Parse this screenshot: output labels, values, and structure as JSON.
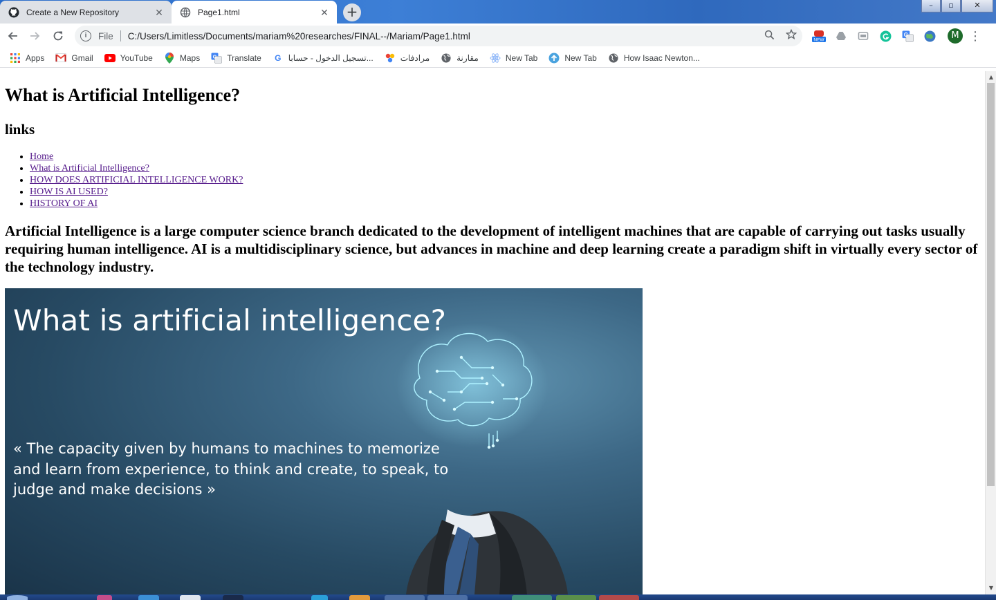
{
  "browser": {
    "tabs": [
      {
        "title": "Create a New Repository",
        "icon": "github-icon",
        "active": false
      },
      {
        "title": "Page1.html",
        "icon": "globe-icon",
        "active": true
      }
    ],
    "window_controls": {
      "minimize": "–",
      "maximize": "▫",
      "close": "✕"
    },
    "address": {
      "scheme": "File",
      "url": "C:/Users/Limitless/Documents/mariam%20researches/FINAL--/Mariam/Page1.html"
    },
    "profile_initial": "M",
    "extensions": [
      {
        "name": "new-badge-extension",
        "color": "#d93025",
        "badge": "NEW"
      },
      {
        "name": "drive-extension",
        "color": "#9aa0a6"
      },
      {
        "name": "cast-extension",
        "color": "#9aa0a6"
      },
      {
        "name": "grammarly-extension",
        "color": "#15c39a"
      },
      {
        "name": "translate-extension",
        "color": "#4285f4"
      },
      {
        "name": "globe-extension",
        "color": "#34a853"
      }
    ],
    "bookmarks": [
      {
        "label": "Apps",
        "icon": "apps-grid-icon"
      },
      {
        "label": "Gmail",
        "icon": "gmail-icon"
      },
      {
        "label": "YouTube",
        "icon": "youtube-icon"
      },
      {
        "label": "Maps",
        "icon": "maps-pin-icon"
      },
      {
        "label": "Translate",
        "icon": "translate-icon"
      },
      {
        "label": "تسجيل الدخول - حسابا...",
        "icon": "google-icon"
      },
      {
        "label": "مرادفات",
        "icon": "people-icon"
      },
      {
        "label": "مقارنة",
        "icon": "globe-icon"
      },
      {
        "label": "New Tab",
        "icon": "atom-icon"
      },
      {
        "label": "New Tab",
        "icon": "upload-circle-icon"
      },
      {
        "label": "How Isaac Newton...",
        "icon": "globe-icon"
      }
    ]
  },
  "page": {
    "heading": "What is Artificial Intelligence?",
    "links_heading": "links",
    "links": [
      "Home",
      "What is Artificial Intelligence?",
      "HOW DOES ARTIFICIAL INTELLIGENCE WORK?",
      "HOW IS AI USED?",
      "HISTORY OF AI"
    ],
    "intro": "Artificial Intelligence is a large computer science branch dedicated to the development of intelligent machines that are capable of carrying out tasks usually requiring human intelligence. AI is a multidisciplinary science, but advances in machine and deep learning create a paradigm shift in virtually every sector of the technology industry.",
    "image": {
      "title": "What is artificial intelligence?",
      "quote": "« The capacity given by humans to machines to memorize and learn from experience, to think and create, to speak, to judge and make decisions »"
    }
  },
  "colors": {
    "link_visited": "#551a8b",
    "tab_active_bg": "#ffffff",
    "tab_inactive_bg": "#dee1e6",
    "omnibox_bg": "#f1f3f4",
    "image_bg": "#274a63",
    "brain_glow": "#7fe3ff"
  }
}
